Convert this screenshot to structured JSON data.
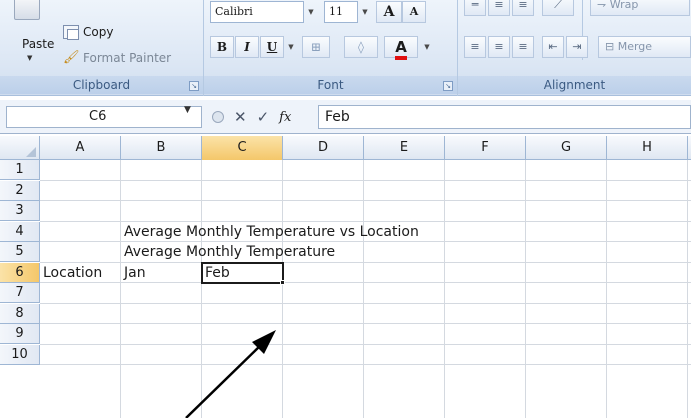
{
  "ribbon": {
    "clipboard": {
      "group_label": "Clipboard",
      "paste_label": "Paste",
      "copy_label": "Copy",
      "format_painter_label": "Format Painter"
    },
    "font": {
      "group_label": "Font",
      "font_name": "Calibri",
      "font_size": "11",
      "grow_font_label": "A",
      "shrink_font_label": "A",
      "bold_label": "B",
      "italic_label": "I",
      "underline_label": "U",
      "font_color_label": "A"
    },
    "alignment": {
      "group_label": "Alignment",
      "wrap_text_label": "Wrap",
      "merge_label": "Merge"
    }
  },
  "formula_bar": {
    "name_box": "C6",
    "formula_value": "Feb",
    "fx_label": "fx"
  },
  "sheet": {
    "columns": [
      "A",
      "B",
      "C",
      "D",
      "E",
      "F",
      "G",
      "H"
    ],
    "active_column": "C",
    "rows": [
      "1",
      "2",
      "3",
      "4",
      "5",
      "6",
      "7",
      "8",
      "9",
      "10"
    ],
    "active_row": "6",
    "cells": {
      "B4": "Average Monthly Temperature vs Location",
      "B5": "Average Monthly Temperature",
      "A6": "Location",
      "B6": "Jan",
      "C6": "Feb"
    }
  },
  "colors": {
    "ribbon_bg": "#dbe6f4",
    "active_header": "#f4c76a",
    "font_color_underline": "#e01010",
    "grid_line": "#d4d9e0"
  }
}
